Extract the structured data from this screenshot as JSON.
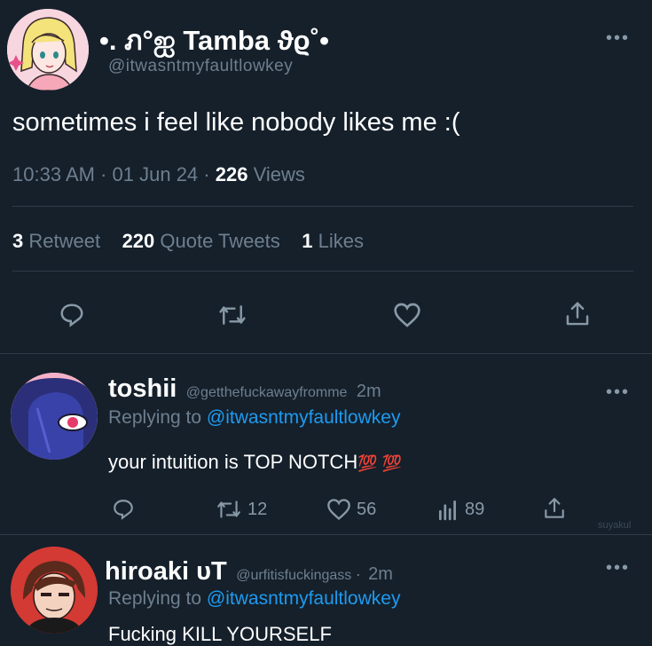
{
  "main_tweet": {
    "display_name": "•. ภ°ஐ Tamba ϑϱ˚•",
    "handle": "@itwasntmyfaultlowkey",
    "text": "sometimes i feel like nobody likes me :(",
    "time": "10:33 AM",
    "date": "01 Jun 24",
    "separator": "·",
    "views_count": "226",
    "views_label": "Views",
    "retweet_count": "3",
    "retweet_label": "Retweet",
    "quote_count": "220",
    "quote_label": "Quote Tweets",
    "likes_count": "1",
    "likes_label": "Likes"
  },
  "replies": [
    {
      "display_name": "toshii",
      "handle": "@getthefuckawayfromme",
      "age": "2m",
      "replying_prefix": "Replying to",
      "replying_handle": "@itwasntmyfaultlowkey",
      "text": "your intuition is TOP NOTCH",
      "emoji": "💯 💯",
      "retweets": "12",
      "likes": "56",
      "views": "89"
    },
    {
      "display_name": "hiroaki ᴜТ",
      "handle": "@urfitisfuckingass",
      "separator": "·",
      "age": "2m",
      "replying_prefix": "Replying to",
      "replying_handle": "@itwasntmyfaultlowkey",
      "text": "Fucking KILL YOURSELF"
    }
  ],
  "watermark": "suyakul",
  "colors": {
    "background": "#15202b",
    "muted": "#6e7f8f",
    "link": "#1d9bf0",
    "divider": "#2f3b47"
  }
}
